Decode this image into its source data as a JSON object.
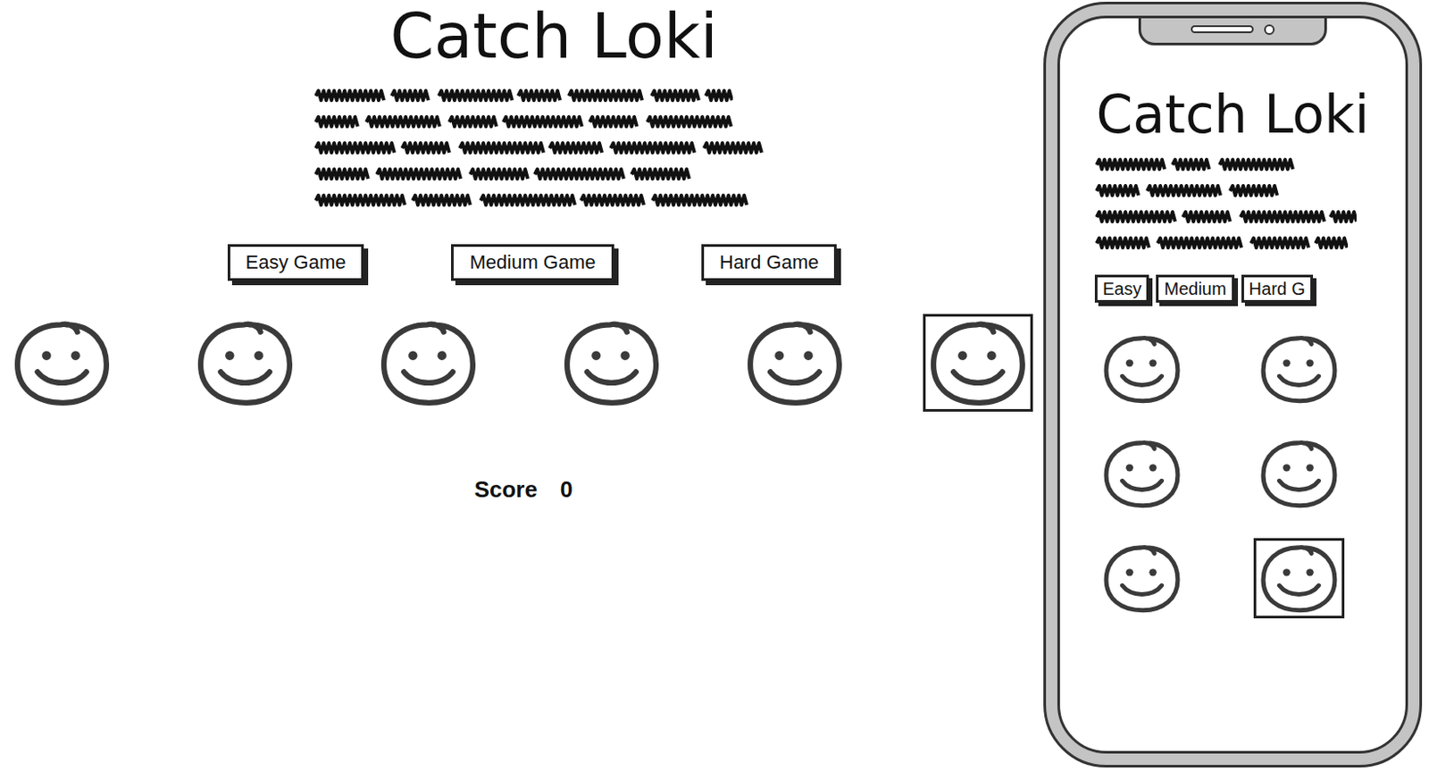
{
  "desktop": {
    "title": "Catch Loki",
    "buttons": [
      "Easy Game",
      "Medium Game",
      "Hard Game"
    ],
    "faces": [
      {
        "selected": false
      },
      {
        "selected": false
      },
      {
        "selected": false
      },
      {
        "selected": false
      },
      {
        "selected": false
      },
      {
        "selected": true
      }
    ],
    "score": {
      "label": "Score",
      "value": "0"
    }
  },
  "phone": {
    "title": "Catch Loki",
    "buttons": [
      "Easy",
      "Medium",
      "Hard G"
    ],
    "faces": [
      {
        "selected": false
      },
      {
        "selected": false
      },
      {
        "selected": false
      },
      {
        "selected": false
      },
      {
        "selected": false
      },
      {
        "selected": true
      }
    ]
  }
}
